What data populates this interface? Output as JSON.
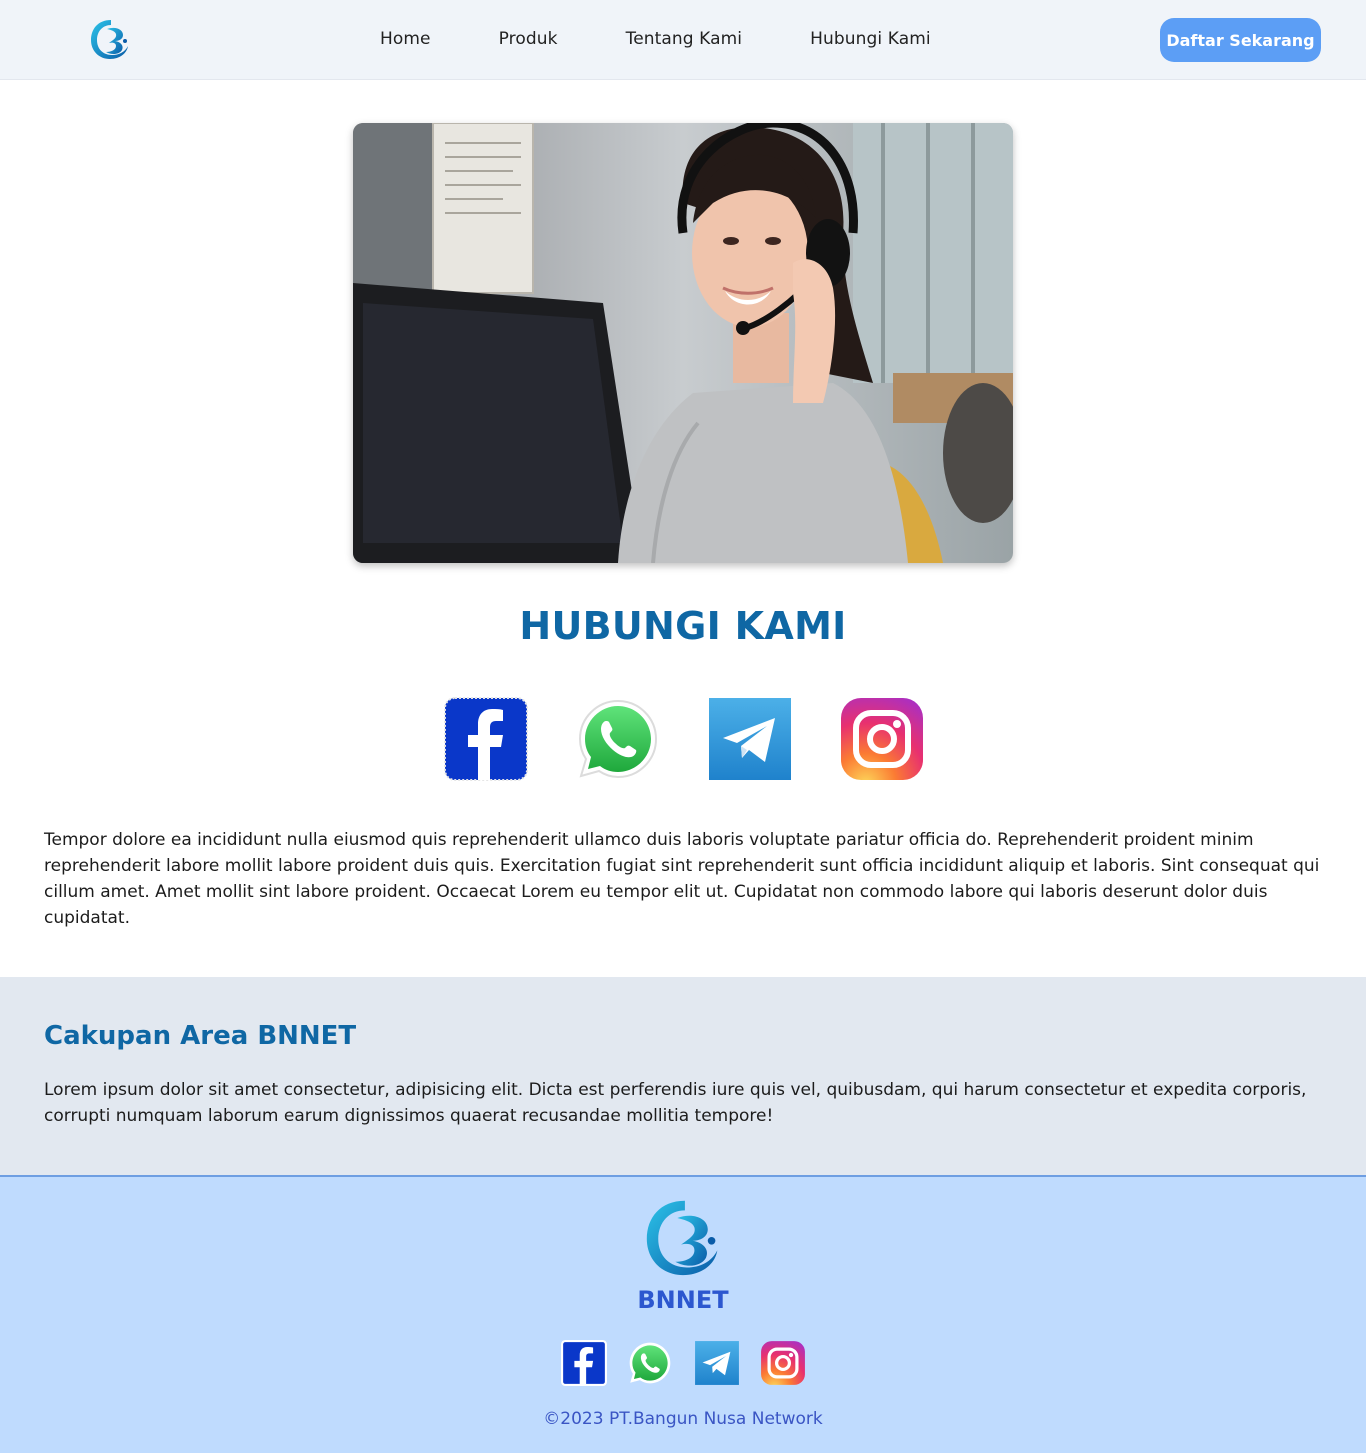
{
  "navbar": {
    "logo_icon": "bnnet-logo-icon",
    "links": [
      "Home",
      "Produk",
      "Tentang Kami",
      "Hubungi Kami"
    ],
    "cta_label": "Daftar Sekarang"
  },
  "hero": {
    "image": "customer-service-agent-photo"
  },
  "contact": {
    "title": "HUBUNGI KAMI",
    "social": [
      "facebook-icon",
      "whatsapp-icon",
      "telegram-icon",
      "instagram-icon"
    ],
    "text": "Tempor dolore ea incididunt nulla eiusmod quis reprehenderit ullamco duis laboris voluptate pariatur officia do. Reprehenderit proident minim reprehenderit labore mollit labore proident duis quis. Exercitation fugiat sint reprehenderit sunt officia incididunt aliquip et laboris. Sint consequat qui cillum amet. Amet mollit sint labore proident. Occaecat Lorem eu tempor elit ut. Cupidatat non commodo labore qui laboris deserunt dolor duis cupidatat."
  },
  "area": {
    "title": "Cakupan Area BNNET",
    "text": "Lorem ipsum dolor sit amet consectetur, adipisicing elit. Dicta est perferendis iure quis vel, quibusdam, qui harum consectetur et expedita corporis, corrupti numquam laborum earum dignissimos quaerat recusandae mollitia tempore!"
  },
  "footer": {
    "brand": "BNNET",
    "social": [
      "facebook-icon",
      "whatsapp-icon",
      "telegram-icon",
      "instagram-icon"
    ],
    "copyright": "©2023 PT.Bangun Nusa Network"
  },
  "colors": {
    "nav_bg": "#f0f4f9",
    "cta_bg": "#5c9ef5",
    "heading_blue": "#0f67a4",
    "area_bg": "#e2e8f0",
    "footer_bg": "#bfdbfe",
    "footer_text": "#3a55c4"
  }
}
